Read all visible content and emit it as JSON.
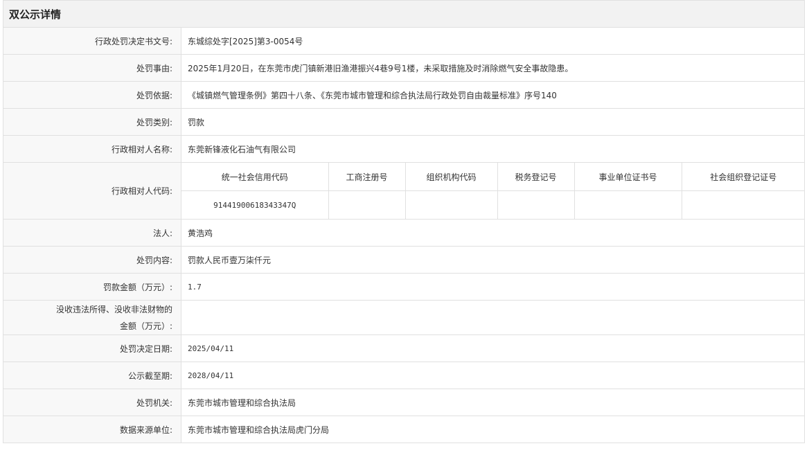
{
  "page_title": "双公示详情",
  "rows": [
    {
      "label": "行政处罚决定书文号:",
      "value": "东城综处字[2025]第3-0054号"
    },
    {
      "label": "处罚事由:",
      "value": "2025年1月20日，在东莞市虎门镇新港旧渔港振兴4巷9号1楼，未采取措施及时消除燃气安全事故隐患。"
    },
    {
      "label": "处罚依据:",
      "value": "《城镇燃气管理条例》第四十八条、《东莞市城市管理和综合执法局行政处罚自由裁量标准》序号140"
    },
    {
      "label": "处罚类别:",
      "value": "罚款"
    },
    {
      "label": "行政相对人名称:",
      "value": "东莞新锋液化石油气有限公司"
    }
  ],
  "codes": {
    "label": "行政相对人代码:",
    "headers": [
      "统一社会信用代码",
      "工商注册号",
      "组织机构代码",
      "税务登记号",
      "事业单位证书号",
      "社会组织登记证号"
    ],
    "values": [
      "91441900618343347Q",
      "",
      "",
      "",
      "",
      ""
    ]
  },
  "rows2": [
    {
      "label": "法人:",
      "value": "黄浩鸡"
    },
    {
      "label": "处罚内容:",
      "value": "罚款人民币壹万柒仟元"
    },
    {
      "label": "罚款金额（万元）:",
      "value": "1.7"
    }
  ],
  "confiscation": {
    "label_line1": "没收违法所得、没收非法财物的",
    "label_line2": "金额（万元）:",
    "value": ""
  },
  "rows3": [
    {
      "label": "处罚决定日期:",
      "value": "2025/04/11"
    },
    {
      "label": "公示截至期:",
      "value": "2028/04/11"
    },
    {
      "label": "处罚机关:",
      "value": "东莞市城市管理和综合执法局"
    },
    {
      "label": "数据来源单位:",
      "value": "东莞市城市管理和综合执法局虎门分局"
    }
  ]
}
